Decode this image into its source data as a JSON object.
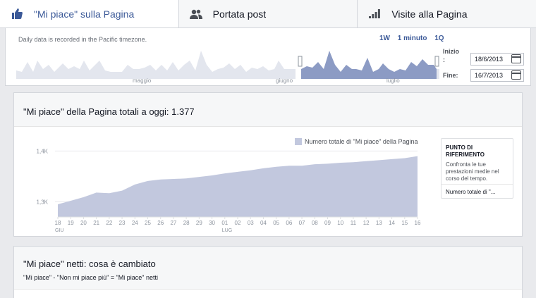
{
  "tabs": [
    {
      "label": "\"Mi piace\" sulla Pagina",
      "icon": "thumbs-up-icon",
      "active": true
    },
    {
      "label": "Portata post",
      "icon": "people-icon",
      "active": false
    },
    {
      "label": "Visite alla Pagina",
      "icon": "bar-chart-icon",
      "active": false
    }
  ],
  "overview": {
    "timezone_note": "Daily data is recorded in the Pacific timezone.",
    "ranges": [
      "1W",
      "1 minuto",
      "1Q"
    ],
    "month_labels": [
      "maggio",
      "giugno",
      "luglio"
    ],
    "start_label": "Inizio :",
    "start_value": "18/6/2013",
    "end_label": "Fine:",
    "end_value": "16/7/2013"
  },
  "likes_card": {
    "title": "\"Mi piace\" della Pagina totali a oggi: 1.377",
    "legend": "Numero totale di \"Mi piace\" della Pagina",
    "benchmark": {
      "title": "PUNTO DI RIFERIMENTO",
      "description": "Confronta le tue prestazioni medie nel corso del tempo.",
      "metric": "Numero totale di \"..."
    }
  },
  "chart_data": {
    "type": "area",
    "series": [
      {
        "name": "Numero totale di \"Mi piace\" della Pagina",
        "color": "#c2c8de"
      }
    ],
    "x": [
      "18",
      "19",
      "20",
      "21",
      "22",
      "23",
      "24",
      "25",
      "26",
      "27",
      "28",
      "29",
      "30",
      "01",
      "02",
      "03",
      "04",
      "05",
      "06",
      "07",
      "08",
      "09",
      "10",
      "11",
      "12",
      "13",
      "14",
      "15",
      "16"
    ],
    "x_month_labels": [
      {
        "at": "18",
        "label": "GIU"
      },
      {
        "at": "01",
        "label": "LUG"
      }
    ],
    "values": [
      1295,
      1302,
      1309,
      1318,
      1317,
      1322,
      1334,
      1341,
      1344,
      1345,
      1346,
      1349,
      1352,
      1356,
      1359,
      1362,
      1366,
      1369,
      1371,
      1371,
      1374,
      1375,
      1377,
      1378,
      1380,
      1382,
      1384,
      1386,
      1390
    ],
    "y_ticks": [
      "1,3K",
      "1,4K"
    ],
    "y_tick_values": [
      1300,
      1400
    ],
    "ylim": [
      1270,
      1420
    ],
    "grid": true
  },
  "net_card": {
    "title": "\"Mi piace\" netti: cosa è cambiato",
    "subtitle": "\"Mi piace\" - \"Non mi piace più\" = \"Mi piace\" netti"
  },
  "colors": {
    "accent": "#3b5998",
    "area": "#c2c8de",
    "area_dark": "#8c9bc4"
  }
}
